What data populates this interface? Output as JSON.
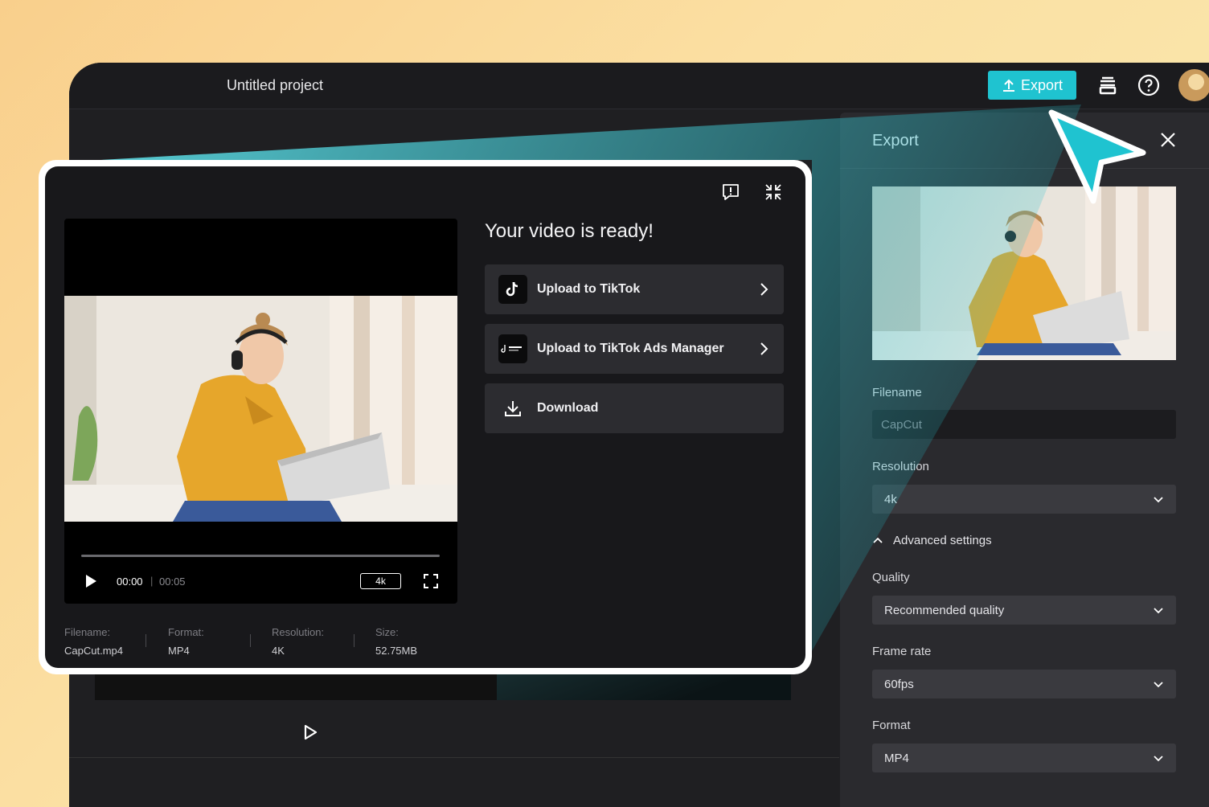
{
  "header": {
    "project_title": "Untitled project",
    "export_label": "Export"
  },
  "export_panel": {
    "title": "Export",
    "filename_label": "Filename",
    "filename_value": "CapCut",
    "resolution_label": "Resolution",
    "resolution_value": "4k",
    "advanced_label": "Advanced settings",
    "quality_label": "Quality",
    "quality_value": "Recommended quality",
    "framerate_label": "Frame rate",
    "framerate_value": "60fps",
    "format_label": "Format",
    "format_value": "MP4"
  },
  "modal": {
    "title": "Your video is ready!",
    "actions": [
      {
        "label": "Upload to TikTok",
        "icon": "tiktok-icon"
      },
      {
        "label": "Upload to TikTok Ads Manager",
        "icon": "tiktok-business-icon"
      },
      {
        "label": "Download",
        "icon": "download-icon"
      }
    ],
    "player": {
      "current_time": "00:00",
      "separator": "|",
      "total_time": "00:05",
      "quality": "4k"
    },
    "meta": {
      "filename_key": "Filename:",
      "filename_val": "CapCut.mp4",
      "format_key": "Format:",
      "format_val": "MP4",
      "resolution_key": "Resolution:",
      "resolution_val": "4K",
      "size_key": "Size:",
      "size_val": "52.75MB"
    }
  },
  "colors": {
    "accent": "#1fc3d0",
    "panel": "#2a2a2e",
    "modal": "#18181b"
  }
}
